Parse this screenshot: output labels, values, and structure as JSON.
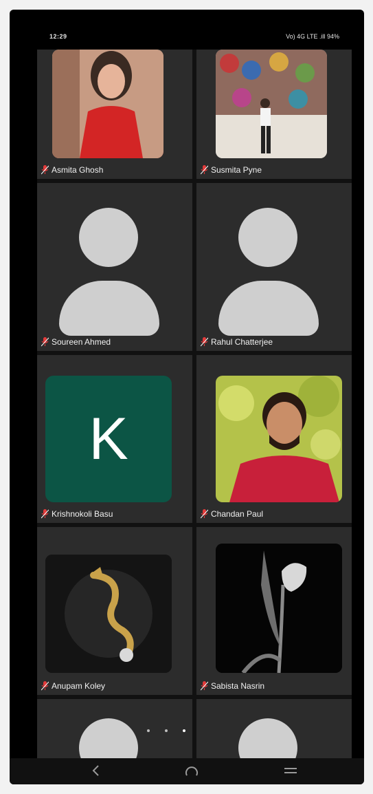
{
  "status_bar": {
    "time": "12:29",
    "right_text": "Vo) 4G LTE .ill 94%"
  },
  "tiles": [
    {
      "name": "Asmita Ghosh"
    },
    {
      "name": "Susmita Pyne"
    },
    {
      "name": "Soureen Ahmed"
    },
    {
      "name": "Rahul Chatterjee"
    },
    {
      "name": "Krishnokoli Basu",
      "letter": "K"
    },
    {
      "name": "Chandan Paul"
    },
    {
      "name": "Anupam Koley"
    },
    {
      "name": "Sabista Nasrin"
    }
  ],
  "colors": {
    "letter_tile_bg": "#0c5545",
    "tile_bg": "#2c2c2c",
    "mic_off": "#e23b3b"
  }
}
